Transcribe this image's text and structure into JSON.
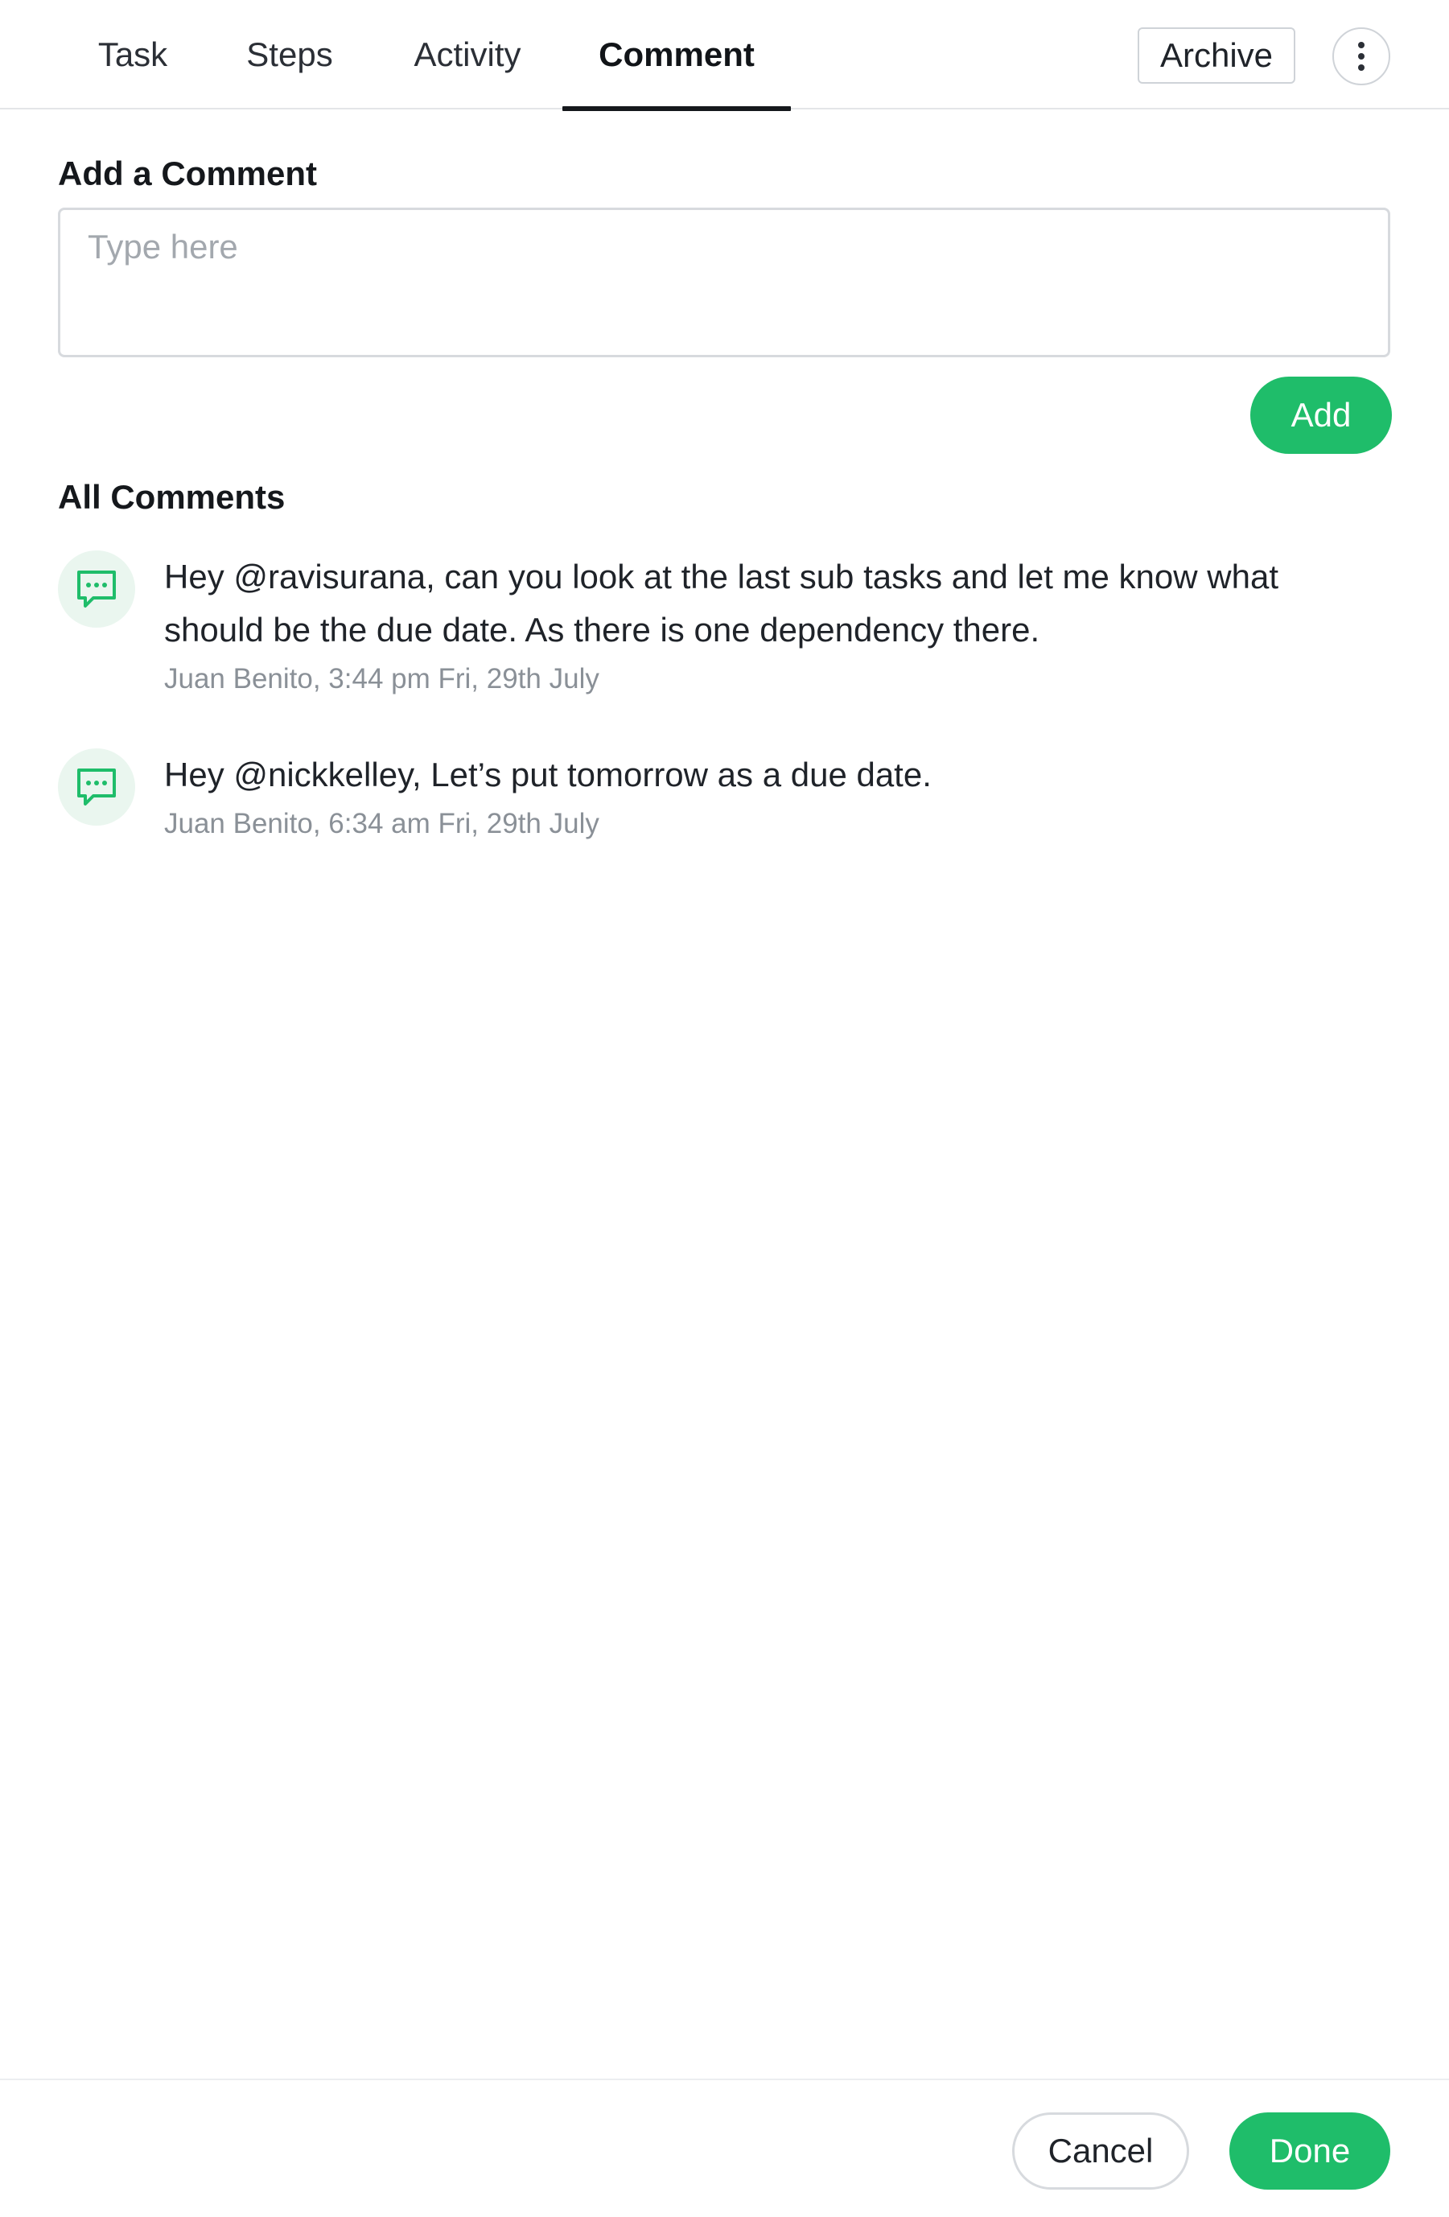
{
  "tabs": [
    {
      "label": "Task",
      "active": false
    },
    {
      "label": "Steps",
      "active": false
    },
    {
      "label": "Activity",
      "active": false
    },
    {
      "label": "Comment",
      "active": true
    }
  ],
  "header": {
    "archive_label": "Archive",
    "more_icon": "vertical-dots-icon"
  },
  "add_comment": {
    "title": "Add a Comment",
    "placeholder": "Type here",
    "value": "",
    "add_label": "Add"
  },
  "all_comments": {
    "title": "All Comments",
    "items": [
      {
        "icon": "chat-bubble-icon",
        "text": "Hey @ravisurana, can you look at the last sub tasks and let me know what should be the due date. As there is one dependency there.",
        "meta": "Juan Benito, 3:44 pm Fri, 29th July"
      },
      {
        "icon": "chat-bubble-icon",
        "text": "Hey @nickkelley, Let’s put tomorrow as a due date.",
        "meta": "Juan Benito, 6:34 am Fri, 29th July"
      }
    ]
  },
  "footer": {
    "cancel_label": "Cancel",
    "done_label": "Done"
  },
  "colors": {
    "accent": "#1fbd6a",
    "icon_bg": "#eaf6ef",
    "text": "#1f2329",
    "muted": "#8a9097"
  }
}
